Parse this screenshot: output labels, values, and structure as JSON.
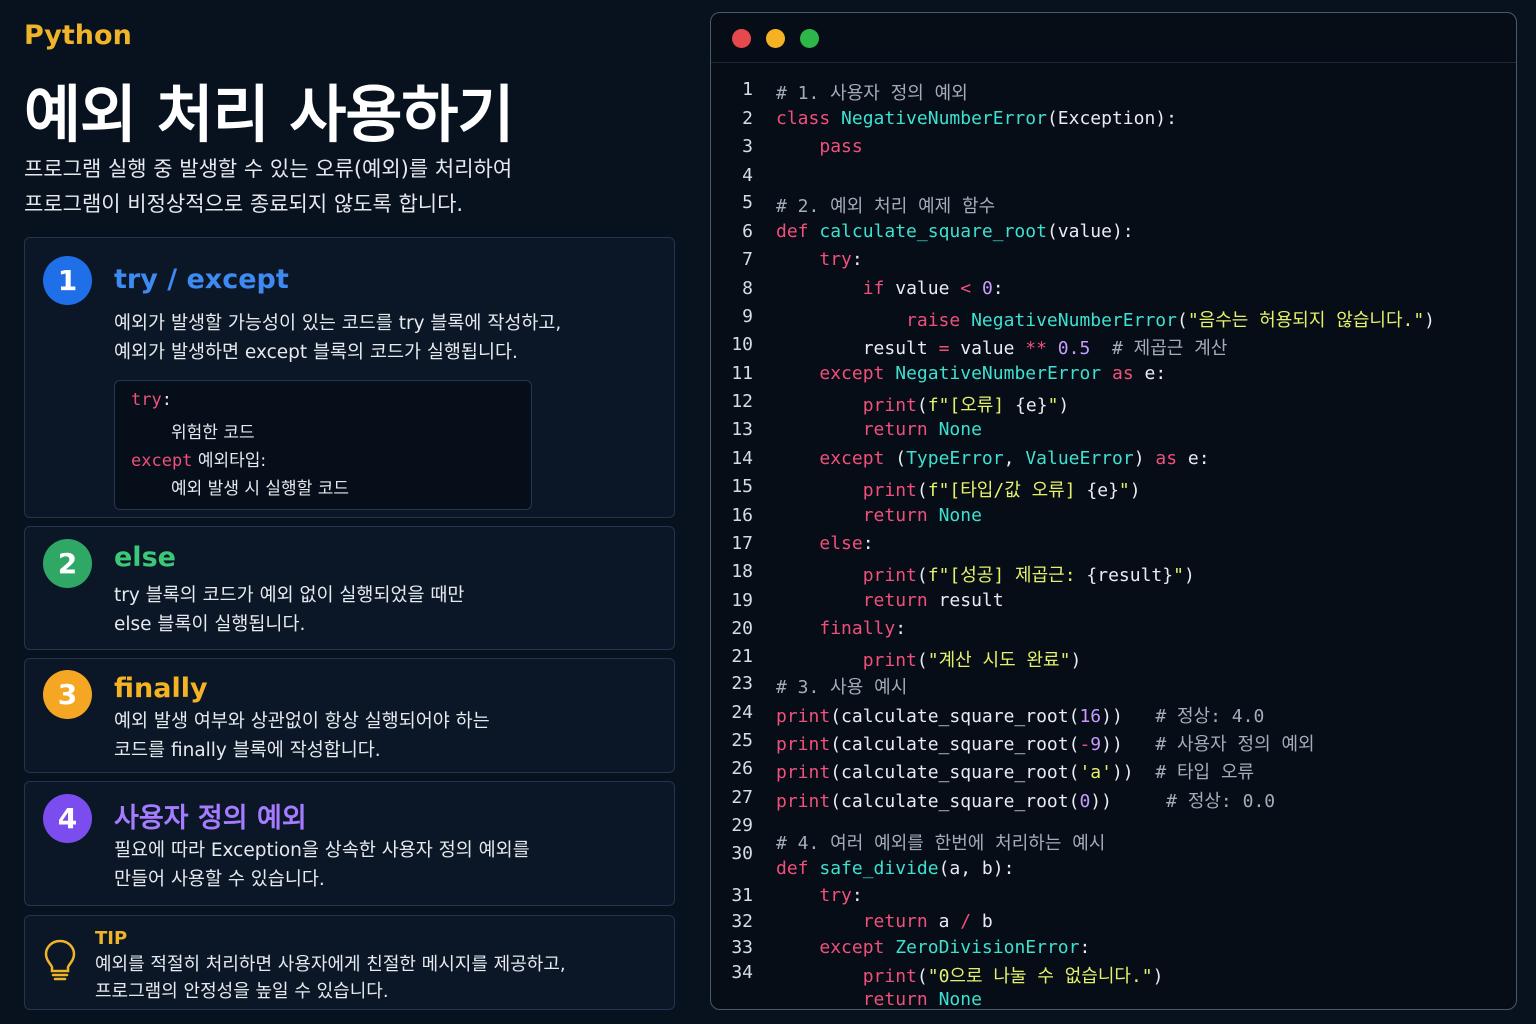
{
  "header": {
    "language": "Python",
    "title": "예외 처리 사용하기",
    "desc_line1": "프로그램 실행 중 발생할 수 있는 오류(예외)를 처리하여",
    "desc_line2": "프로그램이 비정상적으로 종료되지 않도록 합니다."
  },
  "cards": [
    {
      "number": "1",
      "title": "try / except",
      "color": "#3d8bf2",
      "line1": "예외가 발생할 가능성이 있는 코드를 try 블록에 작성하고,",
      "line2": "예외가 발생하면 except 블록의 코드가 실행됩니다.",
      "snippet": {
        "try_kw": "try",
        "colon1": ":",
        "body1": "위험한 코드",
        "except_kw": "except",
        "except_type": " 예외타입:",
        "body2": "예외 발생 시 실행할 코드"
      }
    },
    {
      "number": "2",
      "title": "else",
      "color": "#2fbf71",
      "line1": "try 블록의 코드가 예외 없이 실행되었을 때만",
      "line2": "else 블록이 실행됩니다."
    },
    {
      "number": "3",
      "title": "finally",
      "color": "#f5a623",
      "line1": "예외 발생 여부와 상관없이 항상 실행되어야 하는",
      "line2": "코드를 finally 블록에 작성합니다."
    },
    {
      "number": "4",
      "title": "사용자 정의 예외",
      "color": "#8b5cf6",
      "line1": "필요에 따라 Exception을 상속한 사용자 정의 예외를",
      "line2": "만들어 사용할 수 있습니다."
    }
  ],
  "tip": {
    "label": "TIP",
    "line1": "예외를 적절히 처리하면 사용자에게 친절한 메시지를 제공하고,",
    "line2": "프로그램의 안정성을 높일 수 있습니다."
  },
  "editor": {
    "window_dots": [
      "#e5484d",
      "#f5b324",
      "#2fb64a"
    ],
    "line_numbers": [
      "1",
      "2",
      "3",
      "4",
      "5",
      "6",
      "7",
      "8",
      "9",
      "10",
      "11",
      "12",
      "13",
      "14",
      "15",
      "16",
      "17",
      "18",
      "19",
      "20",
      "21",
      "23",
      "24",
      "25",
      "26",
      "27",
      "29",
      "30",
      "31",
      "32",
      "33",
      "34"
    ],
    "code_lines": [
      [
        [
          "c-com",
          "# 1. 사용자 정의 예외"
        ]
      ],
      [
        [
          "c-kw",
          "class "
        ],
        [
          "c-cls",
          "NegativeNumberError"
        ],
        [
          "c-txt",
          "(Exception):"
        ]
      ],
      [
        [
          "c-txt",
          "    "
        ],
        [
          "c-kw",
          "pass"
        ]
      ],
      [],
      [
        [
          "c-com",
          "# 2. 예외 처리 예제 함수"
        ]
      ],
      [
        [
          "c-kw",
          "def "
        ],
        [
          "c-fn",
          "calculate_square_root"
        ],
        [
          "c-txt",
          "(value):"
        ]
      ],
      [
        [
          "c-txt",
          "    "
        ],
        [
          "c-kw",
          "try"
        ],
        [
          "c-txt",
          ":"
        ]
      ],
      [
        [
          "c-txt",
          "        "
        ],
        [
          "c-kw",
          "if"
        ],
        [
          "c-txt",
          " value "
        ],
        [
          "c-op",
          "<"
        ],
        [
          "c-txt",
          " "
        ],
        [
          "c-num",
          "0"
        ],
        [
          "c-txt",
          ":"
        ]
      ],
      [
        [
          "c-txt",
          "            "
        ],
        [
          "c-kw",
          "raise"
        ],
        [
          "c-txt",
          " "
        ],
        [
          "c-cls",
          "NegativeNumberError"
        ],
        [
          "c-txt",
          "("
        ],
        [
          "c-str",
          "\"음수는 허용되지 않습니다.\""
        ],
        [
          "c-txt",
          ")"
        ]
      ],
      [
        [
          "c-txt",
          "        result "
        ],
        [
          "c-op",
          "="
        ],
        [
          "c-txt",
          " value "
        ],
        [
          "c-op",
          "**"
        ],
        [
          "c-txt",
          " "
        ],
        [
          "c-num",
          "0.5"
        ],
        [
          "c-txt",
          "  "
        ],
        [
          "c-com",
          "# 제곱근 계산"
        ]
      ],
      [
        [
          "c-txt",
          "    "
        ],
        [
          "c-kw",
          "except"
        ],
        [
          "c-txt",
          " "
        ],
        [
          "c-cls",
          "NegativeNumberError"
        ],
        [
          "c-txt",
          " "
        ],
        [
          "c-kw",
          "as"
        ],
        [
          "c-txt",
          " e:"
        ]
      ],
      [
        [
          "c-txt",
          "        "
        ],
        [
          "c-kw",
          "print"
        ],
        [
          "c-txt",
          "("
        ],
        [
          "c-str",
          "f\"[오류] "
        ],
        [
          "c-txt",
          "{e}"
        ],
        [
          "c-str",
          "\""
        ],
        [
          "c-txt",
          ")"
        ]
      ],
      [
        [
          "c-txt",
          "        "
        ],
        [
          "c-kw",
          "return"
        ],
        [
          "c-txt",
          " "
        ],
        [
          "c-cls",
          "None"
        ]
      ],
      [
        [
          "c-txt",
          "    "
        ],
        [
          "c-kw",
          "except"
        ],
        [
          "c-txt",
          " ("
        ],
        [
          "c-cls",
          "TypeError"
        ],
        [
          "c-txt",
          ", "
        ],
        [
          "c-cls",
          "ValueError"
        ],
        [
          "c-txt",
          ") "
        ],
        [
          "c-kw",
          "as"
        ],
        [
          "c-txt",
          " e:"
        ]
      ],
      [
        [
          "c-txt",
          "        "
        ],
        [
          "c-kw",
          "print"
        ],
        [
          "c-txt",
          "("
        ],
        [
          "c-str",
          "f\"[타입/값 오류] "
        ],
        [
          "c-txt",
          "{e}"
        ],
        [
          "c-str",
          "\""
        ],
        [
          "c-txt",
          ")"
        ]
      ],
      [
        [
          "c-txt",
          "        "
        ],
        [
          "c-kw",
          "return"
        ],
        [
          "c-txt",
          " "
        ],
        [
          "c-cls",
          "None"
        ]
      ],
      [
        [
          "c-txt",
          "    "
        ],
        [
          "c-kw",
          "else"
        ],
        [
          "c-txt",
          ":"
        ]
      ],
      [
        [
          "c-txt",
          "        "
        ],
        [
          "c-kw",
          "print"
        ],
        [
          "c-txt",
          "("
        ],
        [
          "c-str",
          "f\"[성공] 제곱근: "
        ],
        [
          "c-txt",
          "{result}"
        ],
        [
          "c-str",
          "\""
        ],
        [
          "c-txt",
          ")"
        ]
      ],
      [
        [
          "c-txt",
          "        "
        ],
        [
          "c-kw",
          "return"
        ],
        [
          "c-txt",
          " result"
        ]
      ],
      [
        [
          "c-txt",
          "    "
        ],
        [
          "c-kw",
          "finally"
        ],
        [
          "c-txt",
          ":"
        ]
      ],
      [
        [
          "c-txt",
          "        "
        ],
        [
          "c-kw",
          "print"
        ],
        [
          "c-txt",
          "("
        ],
        [
          "c-str",
          "\"계산 시도 완료\""
        ],
        [
          "c-txt",
          ")"
        ]
      ],
      [
        [
          "c-com",
          "# 3. 사용 예시"
        ]
      ],
      [
        [
          "c-kw",
          "print"
        ],
        [
          "c-txt",
          "(calculate_square_root("
        ],
        [
          "c-num",
          "16"
        ],
        [
          "c-txt",
          "))   "
        ],
        [
          "c-com",
          "# 정상: 4.0"
        ]
      ],
      [
        [
          "c-kw",
          "print"
        ],
        [
          "c-txt",
          "(calculate_square_root("
        ],
        [
          "c-op",
          "-"
        ],
        [
          "c-num",
          "9"
        ],
        [
          "c-txt",
          "))   "
        ],
        [
          "c-com",
          "# 사용자 정의 예외"
        ]
      ],
      [
        [
          "c-kw",
          "print"
        ],
        [
          "c-txt",
          "(calculate_square_root("
        ],
        [
          "c-str",
          "'a'"
        ],
        [
          "c-txt",
          "))  "
        ],
        [
          "c-com",
          "# 타입 오류"
        ]
      ],
      [
        [
          "c-kw",
          "print"
        ],
        [
          "c-txt",
          "(calculate_square_root("
        ],
        [
          "c-num",
          "0"
        ],
        [
          "c-txt",
          "))     "
        ],
        [
          "c-com",
          "# 정상: 0.0"
        ]
      ],
      [
        [
          "c-com",
          "# 4. 여러 예외를 한번에 처리하는 예시"
        ]
      ],
      [
        [
          "c-kw",
          "def "
        ],
        [
          "c-fn",
          "safe_divide"
        ],
        [
          "c-txt",
          "(a, b):"
        ]
      ],
      [
        [
          "c-txt",
          "    "
        ],
        [
          "c-kw",
          "try"
        ],
        [
          "c-txt",
          ":"
        ]
      ],
      [
        [
          "c-txt",
          "        "
        ],
        [
          "c-kw",
          "return"
        ],
        [
          "c-txt",
          " a "
        ],
        [
          "c-op",
          "/"
        ],
        [
          "c-txt",
          " b"
        ]
      ],
      [
        [
          "c-txt",
          "    "
        ],
        [
          "c-kw",
          "except"
        ],
        [
          "c-txt",
          " "
        ],
        [
          "c-cls",
          "ZeroDivisionError"
        ],
        [
          "c-txt",
          ":"
        ]
      ],
      [
        [
          "c-txt",
          "        "
        ],
        [
          "c-kw",
          "print"
        ],
        [
          "c-txt",
          "("
        ],
        [
          "c-str",
          "\"0으로 나눌 수 없습니다.\""
        ],
        [
          "c-txt",
          ")"
        ]
      ],
      [
        [
          "c-txt",
          "        "
        ],
        [
          "c-kw",
          "return"
        ],
        [
          "c-txt",
          " "
        ],
        [
          "c-cls",
          "None"
        ]
      ]
    ]
  }
}
